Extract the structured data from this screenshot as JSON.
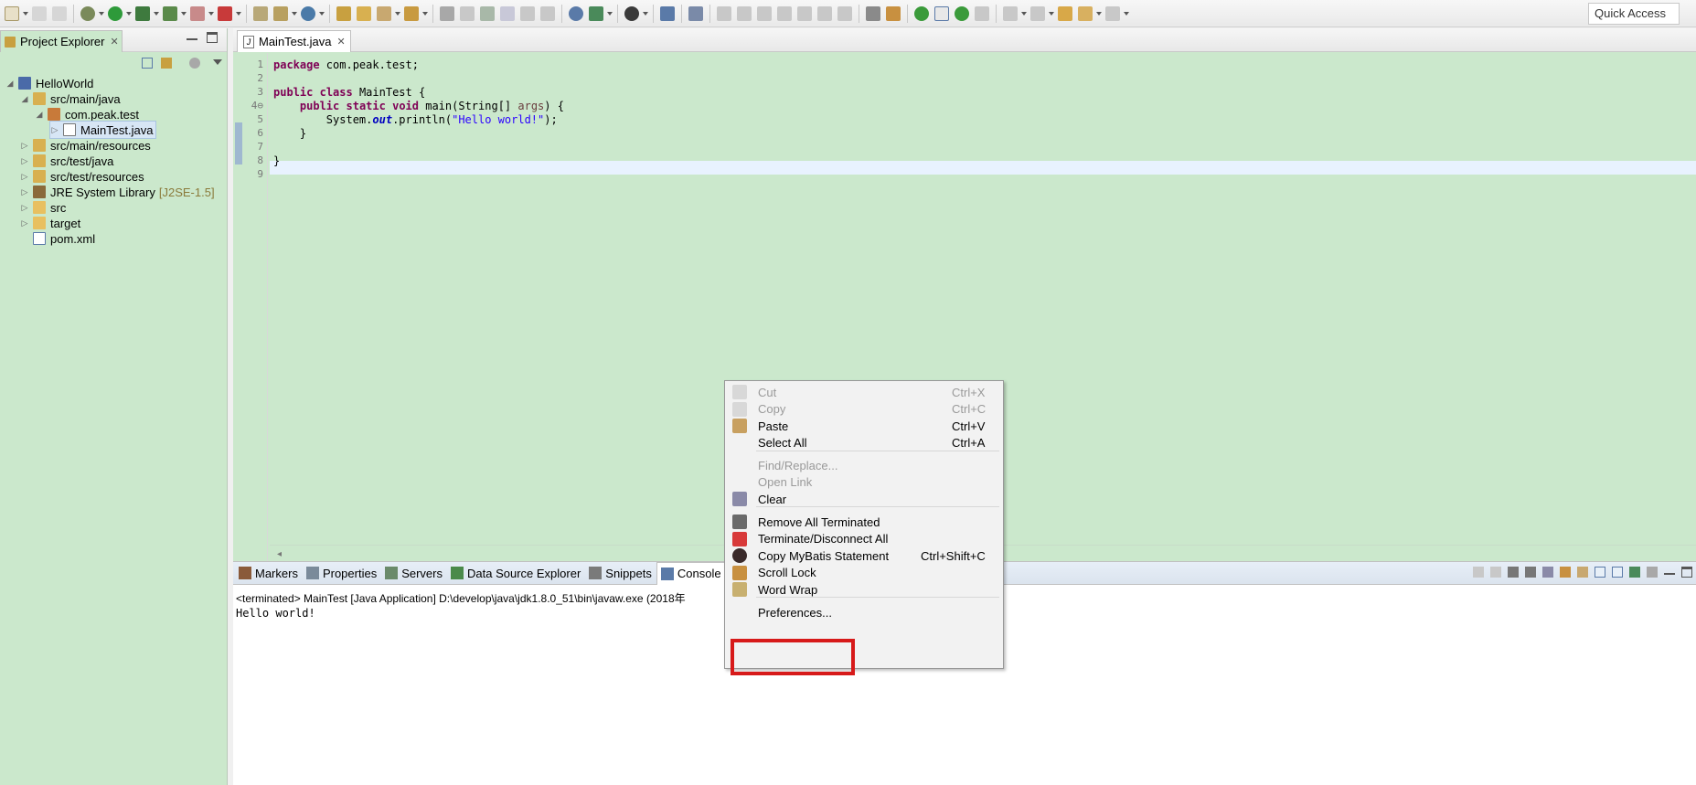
{
  "toolbar": {
    "quick_access": "Quick Access"
  },
  "explorer": {
    "title": "Project Explorer",
    "close": "✕",
    "tree": [
      {
        "label": "HelloWorld",
        "depth": 0,
        "open": true,
        "icon": "project-icon"
      },
      {
        "label": "src/main/java",
        "depth": 1,
        "open": true,
        "icon": "source-folder-icon"
      },
      {
        "label": "com.peak.test",
        "depth": 2,
        "open": true,
        "icon": "package-icon"
      },
      {
        "label": "MainTest.java",
        "depth": 3,
        "open": false,
        "icon": "java-file-icon"
      },
      {
        "label": "src/main/resources",
        "depth": 1,
        "open": false,
        "icon": "source-folder-icon"
      },
      {
        "label": "src/test/java",
        "depth": 1,
        "open": false,
        "icon": "source-folder-icon"
      },
      {
        "label": "src/test/resources",
        "depth": 1,
        "open": false,
        "icon": "source-folder-icon"
      },
      {
        "label": "JRE System Library",
        "tag": "[J2SE-1.5]",
        "depth": 1,
        "open": false,
        "icon": "library-icon"
      },
      {
        "label": "src",
        "depth": 1,
        "open": false,
        "icon": "folder-icon"
      },
      {
        "label": "target",
        "depth": 1,
        "open": false,
        "icon": "folder-icon"
      },
      {
        "label": "pom.xml",
        "depth": 1,
        "open": null,
        "icon": "xml-file-icon"
      }
    ]
  },
  "editor": {
    "tab_label": "MainTest.java",
    "tab_close": "✕",
    "line_numbers": [
      "1",
      "2",
      "3",
      "4⊖",
      "5",
      "6",
      "7",
      "8",
      "9"
    ],
    "code": {
      "l1_kw": "package",
      "l1_rest": " com.peak.test;",
      "l3_kw1": "public",
      "l3_kw2": "class",
      "l3_rest": " MainTest {",
      "l4_kw1": "public",
      "l4_kw2": "static",
      "l4_kw3": "void",
      "l4_mid": " main(String[] ",
      "l4_param": "args",
      "l4_end": ") {",
      "l5_pre": "        System.",
      "l5_field": "out",
      "l5_mid": ".println(",
      "l5_str": "\"Hello world!\"",
      "l5_end": ");",
      "l6": "    }",
      "l8": "}"
    }
  },
  "console": {
    "tabs": [
      {
        "label": "Markers",
        "icon": "markers-icon"
      },
      {
        "label": "Properties",
        "icon": "properties-icon"
      },
      {
        "label": "Servers",
        "icon": "servers-icon"
      },
      {
        "label": "Data Source Explorer",
        "icon": "data-source-icon"
      },
      {
        "label": "Snippets",
        "icon": "snippets-icon"
      },
      {
        "label": "Console",
        "icon": "console-icon"
      }
    ],
    "status": "<terminated> MainTest [Java Application] D:\\develop\\java\\jdk1.8.0_51\\bin\\javaw.exe (2018年",
    "output": "Hello world!"
  },
  "context_menu": {
    "items": [
      {
        "label": "Cut",
        "shortcut": "Ctrl+X",
        "enabled": false,
        "icon": "cut-icon"
      },
      {
        "label": "Copy",
        "shortcut": "Ctrl+C",
        "enabled": false,
        "icon": "copy-icon"
      },
      {
        "label": "Paste",
        "shortcut": "Ctrl+V",
        "enabled": true,
        "icon": "paste-icon"
      },
      {
        "label": "Select All",
        "shortcut": "Ctrl+A",
        "enabled": true,
        "icon": ""
      },
      {
        "label": "Find/Replace...",
        "shortcut": "",
        "enabled": false,
        "icon": ""
      },
      {
        "label": "Open Link",
        "shortcut": "",
        "enabled": false,
        "icon": ""
      },
      {
        "label": "Clear",
        "shortcut": "",
        "enabled": true,
        "icon": "clear-icon"
      },
      {
        "label": "Remove All Terminated",
        "shortcut": "",
        "enabled": true,
        "icon": "remove-all-terminated-icon"
      },
      {
        "label": "Terminate/Disconnect All",
        "shortcut": "",
        "enabled": true,
        "icon": "terminate-icon"
      },
      {
        "label": "Copy MyBatis Statement",
        "shortcut": "Ctrl+Shift+C",
        "enabled": true,
        "icon": "mybatis-icon"
      },
      {
        "label": "Scroll Lock",
        "shortcut": "",
        "enabled": true,
        "icon": "scroll-lock-icon"
      },
      {
        "label": "Word Wrap",
        "shortcut": "",
        "enabled": true,
        "icon": "word-wrap-icon"
      },
      {
        "label": "Preferences...",
        "shortcut": "",
        "enabled": true,
        "icon": ""
      }
    ]
  },
  "colors": {
    "editor_bg": "#cbe8cc",
    "highlight_box": "#d71a1a",
    "keyword": "#7f0055",
    "string": "#2a00ff"
  }
}
